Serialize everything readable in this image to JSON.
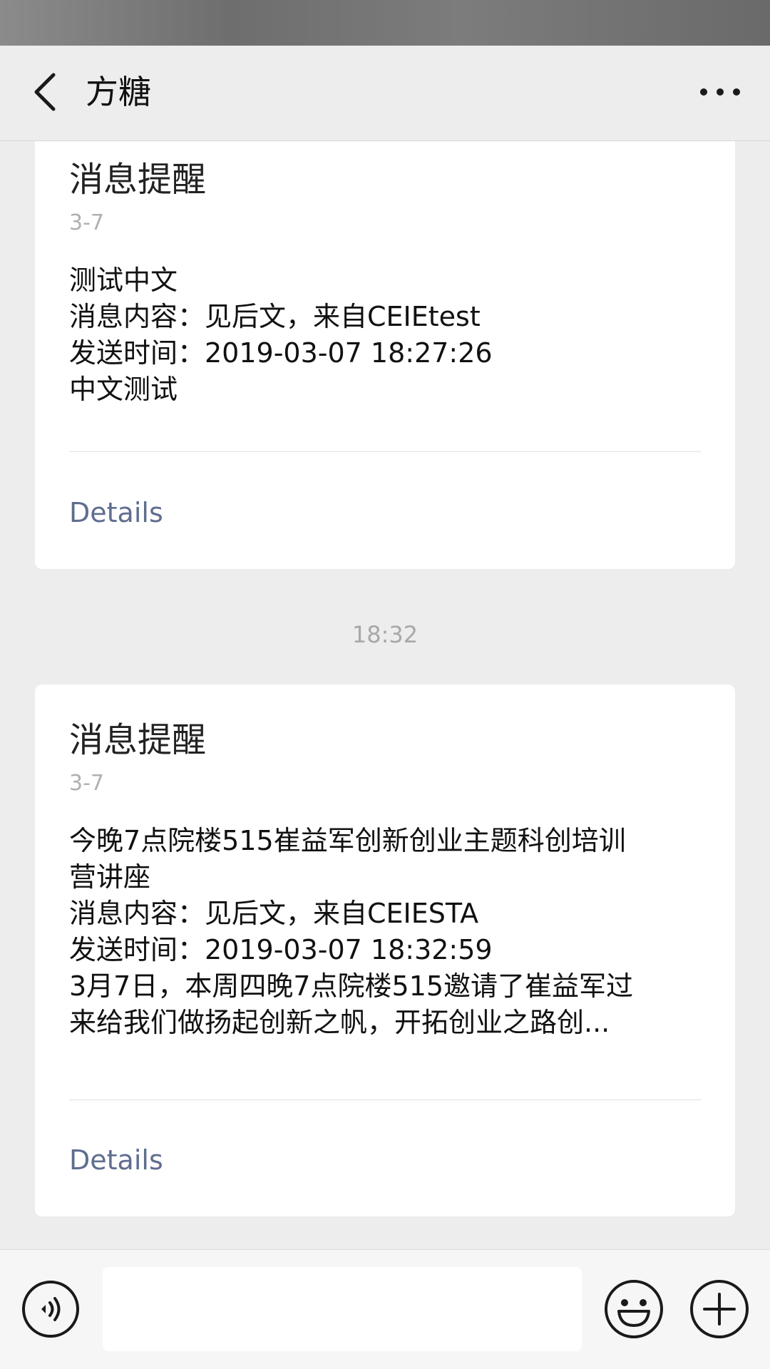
{
  "header": {
    "title": "方糖",
    "back_icon": "back-chevron-icon",
    "more_icon": "more-dots-icon"
  },
  "messages": [
    {
      "title": "消息提醒",
      "date": "3-7",
      "body_lines": [
        "测试中文",
        "消息内容：见后文，来自CEIEtest",
        "发送时间：2019-03-07 18:27:26",
        "中文测试"
      ],
      "link": "Details"
    },
    {
      "title": "消息提醒",
      "date": "3-7",
      "body_lines": [
        "今晚7点院楼515崔益军创新创业主题科创培训",
        "营讲座",
        "消息内容：见后文，来自CEIESTA",
        "发送时间：2019-03-07 18:32:59",
        "3月7日，本周四晚7点院楼515邀请了崔益军过",
        "来给我们做扬起创新之帆，开拓创业之路创..."
      ],
      "link": "Details"
    }
  ],
  "time_divider": "18:32",
  "input_bar": {
    "placeholder": "",
    "voice_icon": "voice-icon",
    "emoji_icon": "emoji-icon",
    "plus_icon": "plus-icon"
  },
  "colors": {
    "background": "#ededed",
    "card": "#ffffff",
    "link": "#5f6d8f",
    "muted_text": "#a8a8a8"
  }
}
